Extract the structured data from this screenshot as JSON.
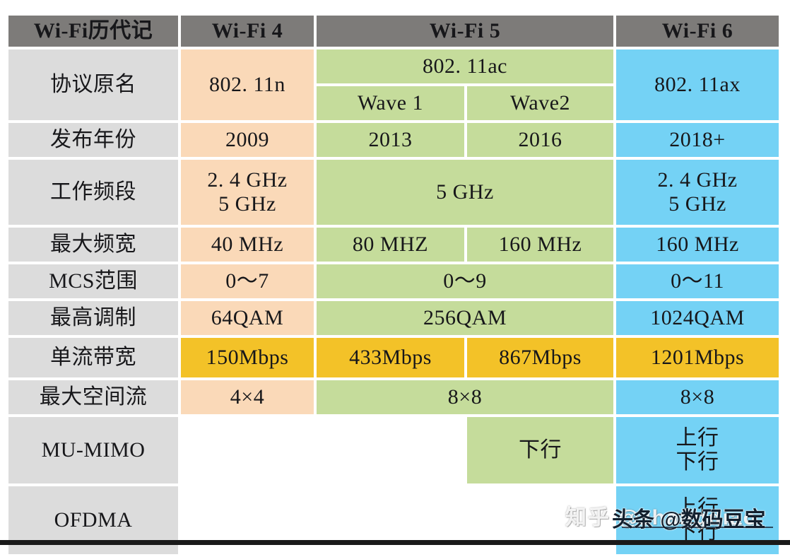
{
  "table": {
    "columns": [
      {
        "key": "label",
        "header": "Wi-Fi历代记"
      },
      {
        "key": "wifi4",
        "header": "Wi-Fi 4"
      },
      {
        "key": "wifi5",
        "header": "Wi-Fi 5"
      },
      {
        "key": "wifi6",
        "header": "Wi-Fi 6"
      }
    ],
    "rows": {
      "protocol": {
        "label": "协议原名",
        "wifi4": "802. 11n",
        "wifi5": "802. 11ac",
        "wifi5_wave1": "Wave 1",
        "wifi5_wave2": "Wave2",
        "wifi6": "802. 11ax"
      },
      "year": {
        "label": "发布年份",
        "wifi4": "2009",
        "wifi5_wave1": "2013",
        "wifi5_wave2": "2016",
        "wifi6": "2018+"
      },
      "band": {
        "label": "工作频段",
        "wifi4": "2. 4 GHz\n5 GHz",
        "wifi5": "5 GHz",
        "wifi6": "2. 4 GHz\n5 GHz"
      },
      "bandwidth": {
        "label": "最大频宽",
        "wifi4": "40 MHz",
        "wifi5_wave1": "80 MHZ",
        "wifi5_wave2": "160 MHz",
        "wifi6": "160 MHz"
      },
      "mcs": {
        "label": "MCS范围",
        "wifi4": "0～7",
        "wifi5": "0～9",
        "wifi6": "0～11"
      },
      "modulation": {
        "label": "最高调制",
        "wifi4": "64QAM",
        "wifi5": "256QAM",
        "wifi6": "1024QAM"
      },
      "stream_rate": {
        "label": "单流带宽",
        "wifi4": "150Mbps",
        "wifi5_wave1": "433Mbps",
        "wifi5_wave2": "867Mbps",
        "wifi6": "1201Mbps"
      },
      "spatial": {
        "label": "最大空间流",
        "wifi4": "4×4",
        "wifi5": "8×8",
        "wifi6": "8×8"
      },
      "mu_mimo": {
        "label": "MU-MIMO",
        "wifi4": "",
        "wifi5_wave1": "",
        "wifi5_wave2": "下行",
        "wifi6": "上行\n下行"
      },
      "ofdma": {
        "label": "OFDMA",
        "wifi4": "",
        "wifi5_wave1": "",
        "wifi5_wave2": "",
        "wifi6": "上行\n下行"
      }
    }
  },
  "watermarks": {
    "zhihu": "知乎 @zhangdiao",
    "toutiao": "头条 @数码豆宝"
  },
  "colors": {
    "header_gray": "#7d7b79",
    "label_gray": "#dcdcdc",
    "wifi4_peach": "#fad9b8",
    "wifi5_green": "#c5dc9b",
    "wifi6_blue": "#74d2f5",
    "highlight_orange": "#f3c228",
    "empty_white": "#ffffff"
  }
}
